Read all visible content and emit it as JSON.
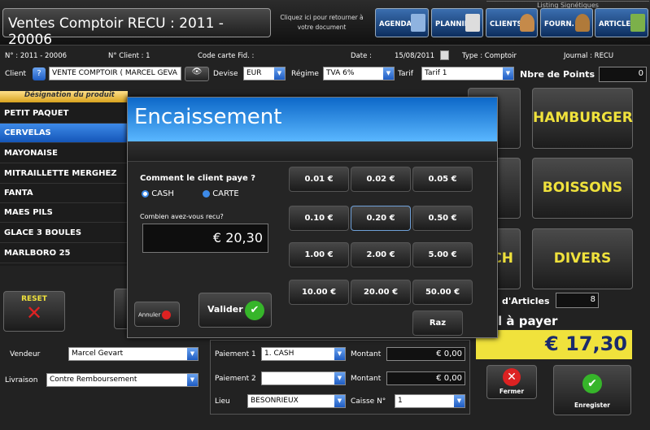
{
  "header": {
    "title": "Ventes Comptoir RECU : 2011 - 20006",
    "hint": "Cliquez ici pour retourner à votre document",
    "listing_label": "Listing Signétiques",
    "buttons": [
      "AGENDA",
      "PLANNING",
      "CLIENTS",
      "FOURN.",
      "ARTICLES"
    ]
  },
  "doc_info": {
    "numero": "N° : 2011 - 20006",
    "client_no": "N° Client : 1",
    "carte_fid": "Code carte Fid. :",
    "date_label": "Date :",
    "date": "15/08/2011",
    "type": "Type : Comptoir",
    "journal": "Journal : RECU"
  },
  "client_row": {
    "client_label": "Client",
    "client_value": "VENTE COMPTOIR ( MARCEL GEVA",
    "devise_label": "Devise",
    "devise": "EUR",
    "regime_label": "Régime",
    "regime": "TVA 6%",
    "tarif_label": "Tarif",
    "tarif": "Tarif 1",
    "points_label": "Nbre de Points",
    "points": "0"
  },
  "products": {
    "header": "Désignation du produit",
    "items": [
      "PETIT PAQUET",
      "CERVELAS",
      "MAYONAISE",
      "MITRAILLETTE MERGHEZ",
      "FANTA",
      "MAES PILS",
      "GLACE 3 BOULES",
      "MARLBORO 25"
    ]
  },
  "categories": [
    "HAMBURGER",
    "BOISSONS",
    "DIVERS"
  ],
  "partial_ch": "CH",
  "bottom": {
    "reset": "RESET",
    "vendeur_label": "Vendeur",
    "vendeur": "Marcel Gevart",
    "livraison_label": "Livraison",
    "livraison": "Contre Remboursement",
    "paiement1_label": "Paiement 1",
    "paiement1": "1. CASH",
    "paiement2_label": "Paiement 2",
    "paiement2": "",
    "montant_label": "Montant",
    "montant1": "€ 0,00",
    "montant2": "€ 0,00",
    "lieu_label": "Lieu",
    "lieu": "BESONRIEUX",
    "caisse_label": "Caisse N°",
    "caisse": "1",
    "articles_label": "d'Articles",
    "articles": "8",
    "total_label": "l à payer",
    "total": "€ 17,30",
    "fermer": "Fermer",
    "enregister": "Enregister"
  },
  "dialog": {
    "title": "Encaissement",
    "question": "Comment le client paye ?",
    "cash": "CASH",
    "carte": "CARTE",
    "recu_label": "Combien avez-vous recu?",
    "recu": "€ 20,30",
    "annuler": "Annuler",
    "valider": "Valider",
    "raz": "Raz",
    "coins": [
      "0.01 €",
      "0.02 €",
      "0.05 €",
      "0.10 €",
      "0.20 €",
      "0.50 €",
      "1.00 €",
      "2.00 €",
      "5.00 €",
      "10.00 €",
      "20.00 €",
      "50.00 €"
    ]
  }
}
